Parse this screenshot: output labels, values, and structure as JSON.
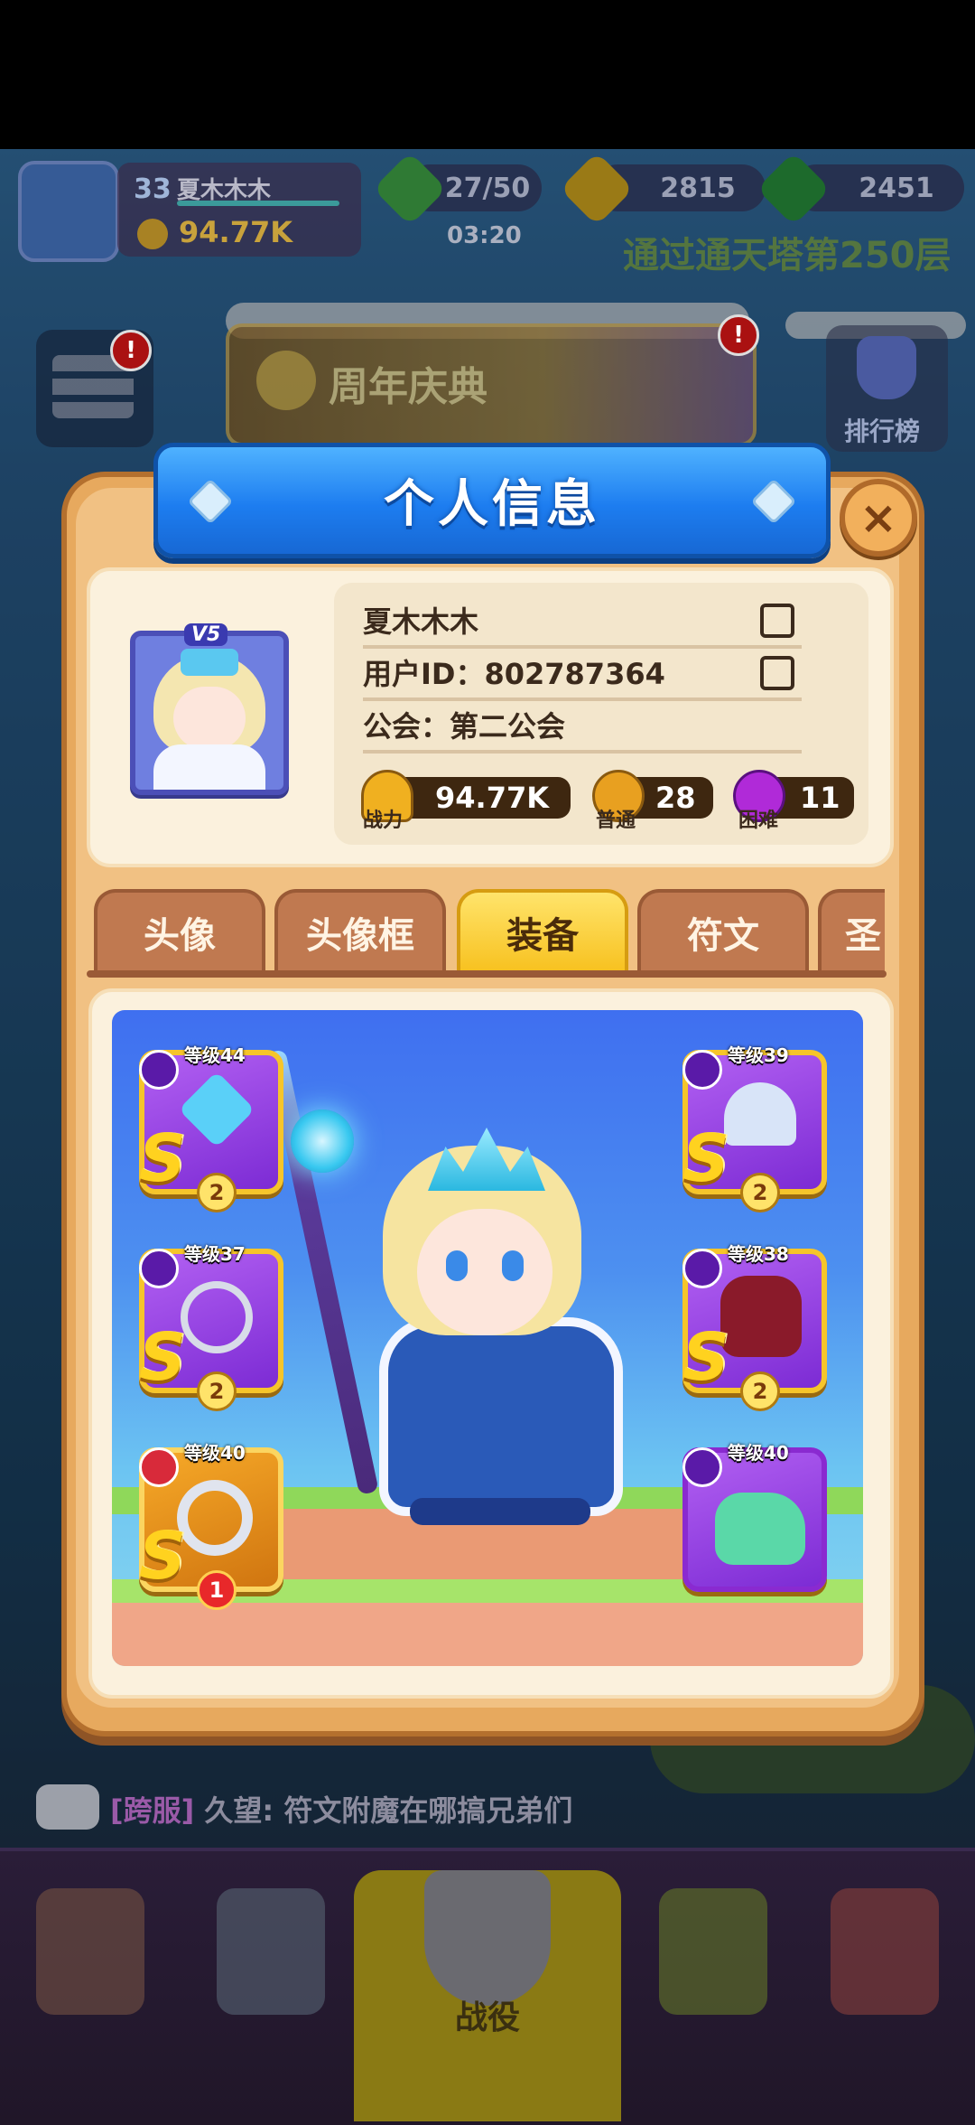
{
  "hud": {
    "player_level": "33",
    "player_name": "夏木木木",
    "power": "94.77K",
    "stamina": "27/50",
    "timer": "03:20",
    "gold": "2815",
    "gems": "2451",
    "scroll_notice": "通过通天塔第250层"
  },
  "lobby": {
    "event_banner": "周年庆典",
    "event_badge": "!",
    "menu_badge": "!",
    "rank_label": "排行榜",
    "chat_tag": "[跨服]",
    "chat_message": "久望: 符文附魔在哪搞兄弟们",
    "nav_battle_label": "战役"
  },
  "dialog": {
    "title": "个人信息",
    "close_icon": "×",
    "avatar_badge": "V5",
    "name": "夏木木木",
    "user_id": "用户ID：802787364",
    "guild": "公会：第二公会",
    "stats": {
      "power_label": "战力",
      "power_value": "94.77K",
      "normal_label": "普通",
      "normal_value": "28",
      "hard_label": "困难",
      "hard_value": "11"
    },
    "tabs": [
      "头像",
      "头像框",
      "装备",
      "符文",
      "圣"
    ],
    "active_tab": "装备"
  },
  "equipment": {
    "weapon": {
      "level": "等级44",
      "grade": "S",
      "stars": "2"
    },
    "armor_head": {
      "level": "等级39",
      "grade": "S",
      "stars": "2"
    },
    "necklace": {
      "level": "等级37",
      "grade": "S",
      "stars": "2"
    },
    "armor_body": {
      "level": "等级38",
      "grade": "S",
      "stars": "2"
    },
    "ring": {
      "level": "等级40",
      "grade": "S",
      "stars": "1"
    },
    "boots": {
      "level": "等级40"
    }
  },
  "colors": {
    "dialog_bg": "#f1c183",
    "header_blue": "#1d7df0",
    "active_tab": "#f7c11f",
    "slot_purple": "#9a3fe0",
    "slot_gold": "#f0a020"
  }
}
